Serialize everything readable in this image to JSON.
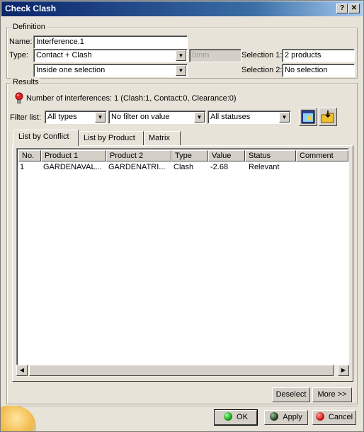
{
  "window": {
    "title": "Check Clash"
  },
  "definition": {
    "group_label": "Definition",
    "name_label": "Name:",
    "name_value": "Interference.1",
    "type_label": "Type:",
    "type_value": "Contact + Clash",
    "clearance_value": "0mm",
    "scope_value": "Inside one selection",
    "selection1_label": "Selection 1:",
    "selection1_value": "2 products",
    "selection2_label": "Selection 2:",
    "selection2_value": "No selection"
  },
  "results": {
    "group_label": "Results",
    "summary": "Number of interferences: 1 (Clash:1, Contact:0, Clearance:0)",
    "filter_label": "Filter list:",
    "filter_type": "All types",
    "filter_value": "No filter on value",
    "filter_status": "All statuses",
    "tabs": [
      "List by Conflict",
      "List by Product",
      "Matrix"
    ],
    "columns": [
      "No.",
      "Product 1",
      "Product 2",
      "Type",
      "Value",
      "Status",
      "Comment"
    ],
    "rows": [
      [
        "1",
        "GARDENAVAL...",
        "GARDENATRI...",
        "Clash",
        "-2.68",
        "Relevant",
        ""
      ]
    ]
  },
  "buttons": {
    "deselect": "Deselect",
    "more": "More >>",
    "ok": "OK",
    "apply": "Apply",
    "cancel": "Cancel"
  },
  "icons": {
    "titlebar": [
      "help-icon",
      "close-icon"
    ],
    "results": [
      "interference-bulb-icon",
      "preview-window-icon",
      "export-folder-icon"
    ],
    "buttons": [
      "ok-green-icon",
      "apply-dark-icon",
      "cancel-red-icon"
    ]
  }
}
